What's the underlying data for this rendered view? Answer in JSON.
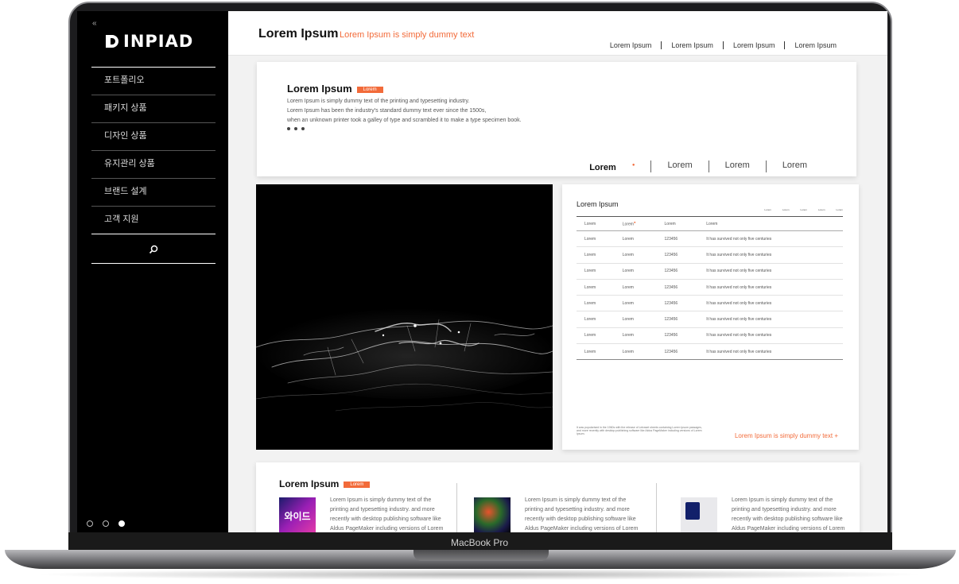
{
  "device": {
    "label": "MacBook Pro"
  },
  "sidebar": {
    "collapse_glyph": "«",
    "logo_text": "INPIAD",
    "items": [
      {
        "label": "포트폴리오"
      },
      {
        "label": "패키지 상품"
      },
      {
        "label": "디자인 상품"
      },
      {
        "label": "유지관리 상품"
      },
      {
        "label": "브랜드 설계"
      },
      {
        "label": "고객 지원"
      }
    ],
    "search_icon": "search-icon",
    "pager": [
      {
        "active": false
      },
      {
        "active": false
      },
      {
        "active": true
      }
    ]
  },
  "header": {
    "title": "Lorem Ipsum",
    "subtitle": "Lorem Ipsum is simply dummy text",
    "nav": [
      "Lorem Ipsum",
      "Lorem Ipsum",
      "Lorem Ipsum",
      "Lorem Ipsum"
    ]
  },
  "intro": {
    "title": "Lorem Ipsum",
    "tag": "Lorem",
    "lines": [
      "Lorem Ipsum is simply dummy text of the printing and typesetting industry.",
      "Lorem Ipsum has been the industry's standard dummy text ever since the 1500s,",
      "when an unknown printer took a galley of type and scrambled it to make a type specimen book."
    ],
    "tabs": [
      "Lorem",
      "Lorem",
      "Lorem",
      "Lorem"
    ]
  },
  "table_card": {
    "title": "Lorem Ipsum",
    "mini_labels": [
      "Lorem",
      "Lorem",
      "Lorem",
      "Lorem",
      "Lorem"
    ],
    "columns": [
      "Lorem",
      "Lorem",
      "Lorem",
      "Lorem"
    ],
    "rows": [
      [
        "Lorem",
        "Lorem",
        "123456",
        "It has survived not only five centuries"
      ],
      [
        "Lorem",
        "Lorem",
        "123456",
        "It has survived not only five centuries"
      ],
      [
        "Lorem",
        "Lorem",
        "123456",
        "It has survived not only five centuries"
      ],
      [
        "Lorem",
        "Lorem",
        "123456",
        "It has survived not only five centuries"
      ],
      [
        "Lorem",
        "Lorem",
        "123456",
        "It has survived not only five centuries"
      ],
      [
        "Lorem",
        "Lorem",
        "123456",
        "It has survived not only five centuries"
      ],
      [
        "Lorem",
        "Lorem",
        "123456",
        "It has survived not only five centuries"
      ],
      [
        "Lorem",
        "Lorem",
        "123456",
        "It has survived not only five centuries"
      ]
    ],
    "note": "It was popularised in the 1960s with the release of Letraset sheets containing Lorem Ipsum passages, and more recently with desktop publishing software like Aldus PageMaker including versions of Lorem Ipsum.",
    "link": "Lorem Ipsum is simply dummy text  +"
  },
  "products": {
    "title": "Lorem Ipsum",
    "tag": "Lorem",
    "items": [
      {
        "thumb_label": "와이드",
        "text": "Lorem Ipsum is simply dummy text of the printing and typesetting industry. and more recently with desktop publishing software like Aldus PageMaker including versions of Lorem"
      },
      {
        "thumb_label": "",
        "text": "Lorem Ipsum is simply dummy text of the printing and typesetting industry. and more recently with desktop publishing software like Aldus PageMaker including versions of Lorem"
      },
      {
        "thumb_label": "",
        "text": "Lorem Ipsum is simply dummy text of the printing and typesetting industry. and more recently with desktop publishing software like Aldus PageMaker including versions of Lorem"
      }
    ]
  },
  "colors": {
    "accent": "#f26b3a",
    "sidebar": "#000000"
  }
}
